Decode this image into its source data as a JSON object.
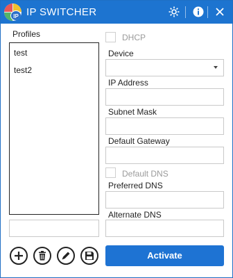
{
  "app": {
    "title": "IP SWITCHER",
    "logo_text": "IP"
  },
  "colors": {
    "titlebar": "#1d74d0",
    "accent": "#1e73d3"
  },
  "titlebar_icons": [
    "gear-icon",
    "info-icon",
    "close-icon"
  ],
  "profiles": {
    "label": "Profiles",
    "items": [
      "test",
      "test2"
    ],
    "name_value": ""
  },
  "form": {
    "dhcp_label": "DHCP",
    "dhcp_checked": false,
    "device_label": "Device",
    "device_value": "",
    "ip_label": "IP Address",
    "ip_value": "",
    "subnet_label": "Subnet Mask",
    "subnet_value": "",
    "gateway_label": "Default Gateway",
    "gateway_value": "",
    "default_dns_label": "Default DNS",
    "default_dns_checked": false,
    "preferred_dns_label": "Preferred DNS",
    "preferred_dns_value": "",
    "alternate_dns_label": "Alternate DNS",
    "alternate_dns_value": ""
  },
  "actions": {
    "icons": [
      "plus-icon",
      "trash-icon",
      "pencil-icon",
      "save-icon"
    ],
    "activate_label": "Activate"
  }
}
